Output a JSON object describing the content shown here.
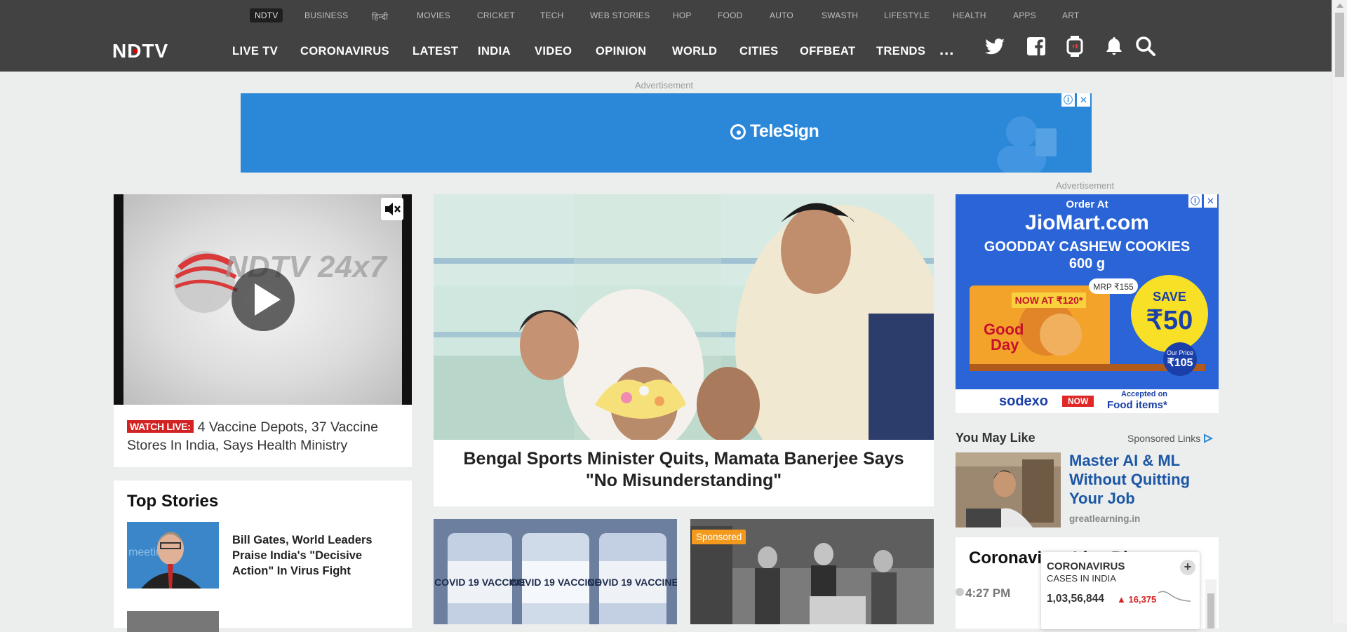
{
  "topnav": {
    "items": [
      "NDTV",
      "BUSINESS",
      "हिन्दी",
      "MOVIES",
      "CRICKET",
      "TECH",
      "WEB STORIES",
      "HOP",
      "FOOD",
      "AUTO",
      "SWASTH",
      "LIFESTYLE",
      "HEALTH",
      "APPS",
      "ART"
    ],
    "active": "NDTV"
  },
  "logo": {
    "text": "NDTV"
  },
  "mainnav": {
    "items": [
      "LIVE TV",
      "CORONAVIRUS",
      "LATEST",
      "INDIA",
      "VIDEO",
      "OPINION",
      "WORLD",
      "CITIES",
      "OFFBEAT",
      "TRENDS"
    ],
    "more": "..."
  },
  "header_icons": [
    "twitter-icon",
    "facebook-icon",
    "smartwatch-icon",
    "bell-icon",
    "search-icon"
  ],
  "ads": {
    "top_label": "Advertisement",
    "top_brand": "TeleSign",
    "right_label": "Advertisement"
  },
  "video": {
    "badge": "WATCH LIVE:",
    "caption": "4 Vaccine Depots, 37 Vaccine Stores In India, Says Health Ministry",
    "channel_logo": "NDTV 24x7"
  },
  "lead": {
    "title": "Bengal Sports Minister Quits, Mamata Banerjee Says \"No Misunderstanding\""
  },
  "top_stories": {
    "heading": "Top Stories",
    "items": [
      {
        "title": "Bill Gates, World Leaders Praise India's \"Decisive Action\" In Virus Fight"
      }
    ]
  },
  "cards": {
    "vaccine_text": [
      "COVID 19 VACCINE",
      "COVID 19 VACCINE",
      "COVID 19 VACCINE"
    ],
    "sponsored_tag": "Sponsored"
  },
  "jio_ad": {
    "line1": "Order At",
    "line2": "JioMart.com",
    "line3": "GOODDAY CASHEW COOKIES",
    "line4": "600 g",
    "mrp": "MRP ₹155",
    "now_at": "NOW AT ₹120*",
    "save": "SAVE",
    "save_amt": "₹50",
    "our_price_label": "Our Price",
    "our_price": "₹105",
    "brand": "sodexo",
    "now_tag": "NOW",
    "accepted": "Accepted on",
    "food_items": "Food items*"
  },
  "you_may_like": {
    "heading": "You May Like",
    "sponsored": "Sponsored Links",
    "item_title": "Master AI & ML Without Quitting Your Job",
    "item_source": "greatlearning.in"
  },
  "coronavirus": {
    "heading": "Coronavirus Live Bl",
    "time": "4:27 PM"
  },
  "covid_widget": {
    "title": "CORONAVIRUS",
    "subtitle": "CASES IN INDIA",
    "count": "1,03,56,844",
    "delta": "16,375",
    "plus": "+"
  },
  "colors": {
    "header_bg": "#424242",
    "page_bg": "#eceded",
    "watch_live_red": "#d22222",
    "sponsored_orange": "#f39a1c",
    "link_blue": "#1b57a5",
    "ad_blue": "#2b87d8",
    "jio_blue": "#2a64d6"
  }
}
